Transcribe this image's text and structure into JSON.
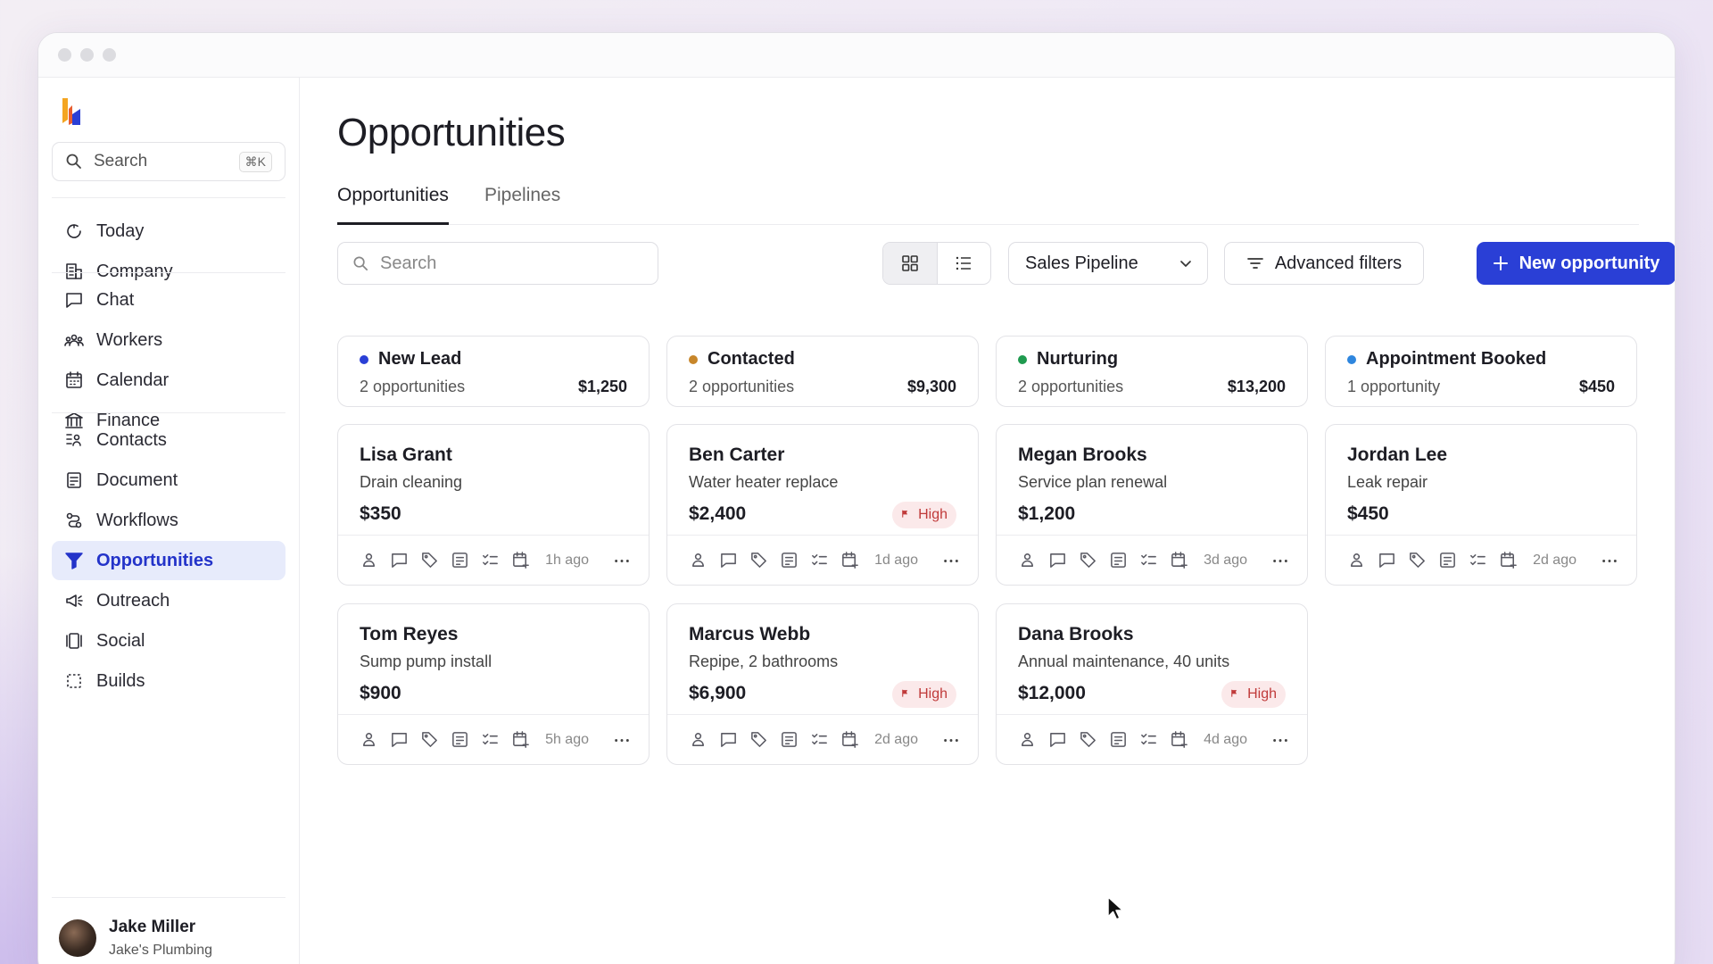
{
  "sidebar": {
    "search_placeholder": "Search",
    "search_shortcut": "⌘K",
    "groups": [
      [
        {
          "label": "Today",
          "icon": "today-icon"
        },
        {
          "label": "Company",
          "icon": "building-icon"
        }
      ],
      [
        {
          "label": "Chat",
          "icon": "chat-icon"
        },
        {
          "label": "Workers",
          "icon": "workers-icon"
        },
        {
          "label": "Calendar",
          "icon": "calendar-icon"
        },
        {
          "label": "Finance",
          "icon": "bank-icon"
        }
      ],
      [
        {
          "label": "Contacts",
          "icon": "contacts-icon"
        },
        {
          "label": "Document",
          "icon": "document-icon"
        },
        {
          "label": "Workflows",
          "icon": "workflows-icon"
        },
        {
          "label": "Opportunities",
          "icon": "funnel-icon"
        },
        {
          "label": "Outreach",
          "icon": "megaphone-icon"
        },
        {
          "label": "Social",
          "icon": "social-icon"
        },
        {
          "label": "Builds",
          "icon": "builds-icon"
        }
      ]
    ],
    "active_item": "Opportunities",
    "user": {
      "name": "Jake Miller",
      "org": "Jake's Plumbing"
    }
  },
  "main": {
    "title": "Opportunities",
    "tabs": [
      {
        "label": "Opportunities",
        "active": true
      },
      {
        "label": "Pipelines",
        "active": false
      }
    ],
    "search_placeholder": "Search",
    "view_mode": "grid",
    "pipeline_select": "Sales Pipeline",
    "advanced_filters_label": "Advanced filters",
    "new_button_label": "New opportunity",
    "accent_color": "#2a3fd6"
  },
  "columns": [
    {
      "title": "New Lead",
      "color": "#2a3fd6",
      "count": "2 opportunities",
      "total": "$1,250",
      "cards": [
        {
          "name": "Lisa Grant",
          "desc": "Drain cleaning",
          "value": "$350",
          "priority": "",
          "time": "1h ago"
        },
        {
          "name": "Tom Reyes",
          "desc": "Sump pump install",
          "value": "$900",
          "priority": "",
          "time": "5h ago"
        }
      ]
    },
    {
      "title": "Contacted",
      "color": "#c7862a",
      "count": "2 opportunities",
      "total": "$9,300",
      "cards": [
        {
          "name": "Ben Carter",
          "desc": "Water heater replace",
          "value": "$2,400",
          "priority": "High",
          "time": "1d ago"
        },
        {
          "name": "Marcus Webb",
          "desc": "Repipe, 2 bathrooms",
          "value": "$6,900",
          "priority": "High",
          "time": "2d ago"
        }
      ]
    },
    {
      "title": "Nurturing",
      "color": "#1f9a4f",
      "count": "2 opportunities",
      "total": "$13,200",
      "cards": [
        {
          "name": "Megan Brooks",
          "desc": "Service plan renewal",
          "value": "$1,200",
          "priority": "",
          "time": "3d ago"
        },
        {
          "name": "Dana Brooks",
          "desc": "Annual maintenance, 40 units",
          "value": "$12,000",
          "priority": "High",
          "time": "4d ago"
        }
      ]
    },
    {
      "title": "Appointment Booked",
      "color": "#2e86de",
      "count": "1 opportunity",
      "total": "$450",
      "cards": [
        {
          "name": "Jordan Lee",
          "desc": "Leak repair",
          "value": "$450",
          "priority": "",
          "time": "2d ago"
        }
      ]
    }
  ]
}
